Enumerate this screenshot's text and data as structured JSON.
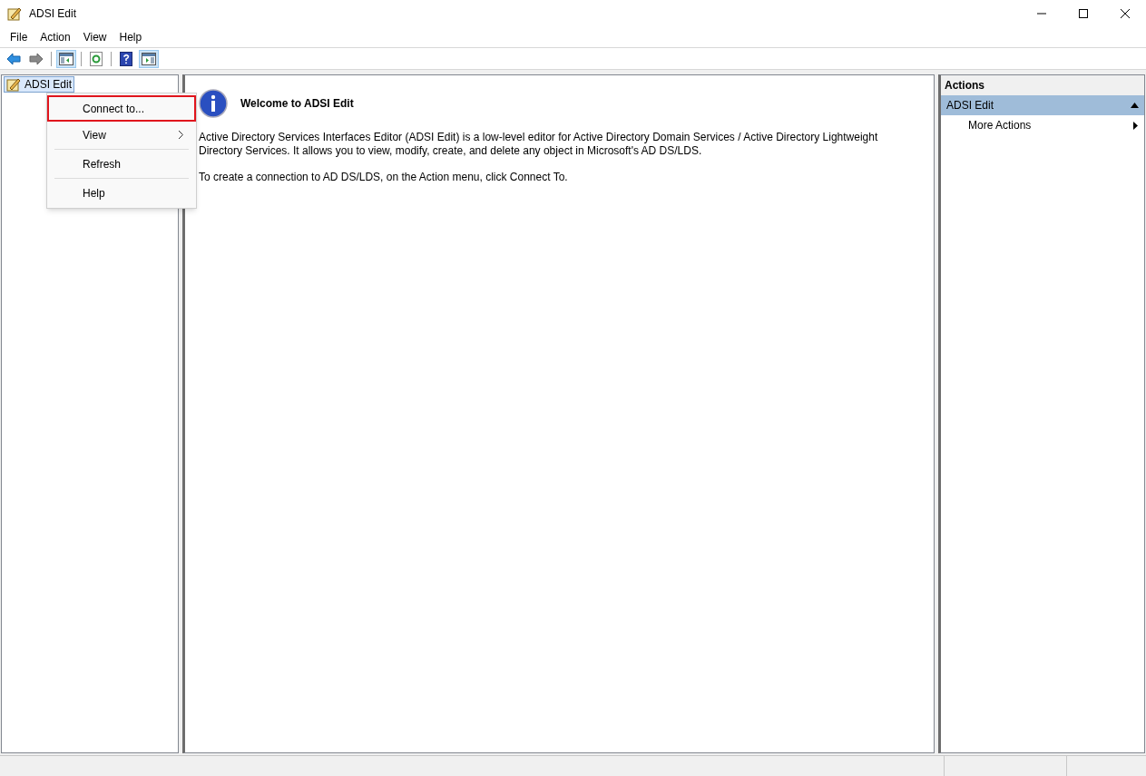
{
  "window": {
    "title": "ADSI Edit"
  },
  "menu_bar": [
    "File",
    "Action",
    "View",
    "Help"
  ],
  "toolbar": [
    {
      "kind": "back",
      "pressed": false
    },
    {
      "kind": "forward",
      "pressed": false
    },
    {
      "kind": "console-tree",
      "pressed": true
    },
    {
      "kind": "refresh",
      "pressed": false
    },
    {
      "kind": "help",
      "pressed": false
    },
    {
      "kind": "action-pane",
      "pressed": true
    }
  ],
  "tree": {
    "items": [
      {
        "label": "ADSI Edit",
        "selected": true
      }
    ]
  },
  "context_menu": {
    "items": [
      {
        "label": "Connect to...",
        "kind": "item",
        "selected": true
      },
      {
        "label": "View",
        "kind": "submenu",
        "selected": false
      },
      {
        "label": "Refresh",
        "kind": "item",
        "selected": false
      },
      {
        "label": "Help",
        "kind": "item",
        "selected": false
      }
    ]
  },
  "welcome": {
    "heading": "Welcome to ADSI Edit",
    "paragraphs": [
      "Active Directory Services Interfaces Editor (ADSI Edit) is a low-level editor for Active Directory Domain Services / Active Directory Lightweight Directory Services. It allows you to view, modify, create, and delete any object in Microsoft's AD DS/LDS.",
      "To create a connection to AD DS/LDS, on the Action menu, click Connect To."
    ]
  },
  "actions": {
    "title": "Actions",
    "section": {
      "label": "ADSI Edit",
      "expanded": true
    },
    "items": [
      "More Actions"
    ]
  }
}
